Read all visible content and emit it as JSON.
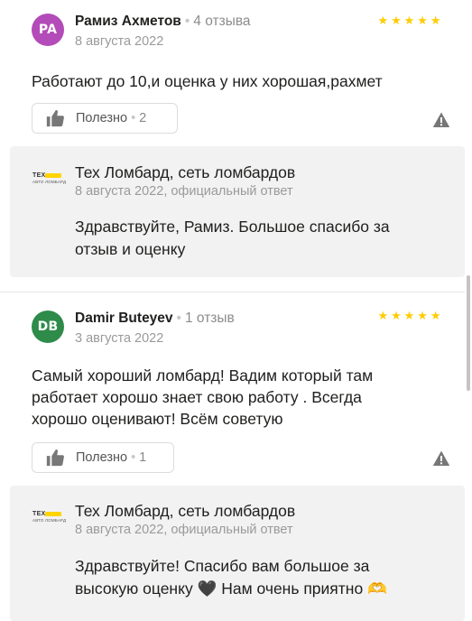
{
  "reviews": [
    {
      "avatar_initials": "PA",
      "avatar_color": "#b34bb8",
      "author": "Рамиз Ахметов",
      "review_count": "4 отзыва",
      "date": "8 августа 2022",
      "rating": 5,
      "text": "Работают до 10,и оценка у них хорошая,рахмет",
      "helpful_label": "Полезно",
      "helpful_count": "2",
      "reply": {
        "org_logo_line1": "ТЕХ",
        "org_logo_line2": "АВТО ЛОМБАРД",
        "org_name": "Тех Ломбард, сеть ломбардов",
        "date": "8 августа 2022, официальный ответ",
        "text_line1": "Здравствуйте, Рамиз. Большое спасибо за",
        "text_line2": "отзыв и оценку"
      }
    },
    {
      "avatar_initials": "DB",
      "avatar_color": "#2e8b4a",
      "author": "Damir Buteyev",
      "review_count": "1 отзыв",
      "date": "3 августа 2022",
      "rating": 5,
      "text_line1": "Самый хороший ломбард! Вадим который там",
      "text_line2": "работает хорошо знает свою работу . Всегда",
      "text_line3": "хорошо оценивают! Всём советую",
      "helpful_label": "Полезно",
      "helpful_count": "1",
      "reply": {
        "org_logo_line1": "ТЕХ",
        "org_logo_line2": "АВТО ЛОМБАРД",
        "org_name": "Тех Ломбард, сеть ломбардов",
        "date": "8 августа 2022, официальный ответ",
        "text_line1": "Здравствуйте! Спасибо вам большое за",
        "text_line2": "высокую оценку 🖤 Нам очень приятно 🫶"
      }
    }
  ],
  "colors": {
    "star": "#ffcc00",
    "reply_bg": "#f2f2f2"
  }
}
